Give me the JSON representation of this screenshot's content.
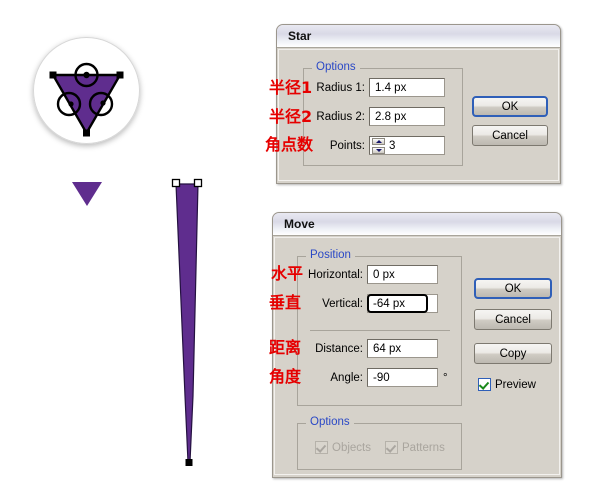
{
  "canvas": {
    "background": "#ffffff",
    "artwork": {
      "purple": "#5f2d8e",
      "outline": "#000000",
      "preview_circle_name": "star-tool-preview",
      "small_triangle_name": "small-purple-triangle",
      "spire_name": "elongated-purple-spire"
    }
  },
  "star_dialog": {
    "title": "Star",
    "group_legend": "Options",
    "fields": [
      {
        "label": "Radius 1:",
        "value": "1.4 px",
        "annotation": "半径1"
      },
      {
        "label": "Radius 2:",
        "value": "2.8 px",
        "annotation": "半径2"
      },
      {
        "label": "Points:",
        "value": "3",
        "annotation": "角点数"
      }
    ],
    "buttons": {
      "ok": "OK",
      "cancel": "Cancel"
    }
  },
  "move_dialog": {
    "title": "Move",
    "position_legend": "Position",
    "options_legend": "Options",
    "fields": [
      {
        "label": "Horizontal:",
        "value": "0 px",
        "annotation": "水平"
      },
      {
        "label": "Vertical:",
        "value": "-64 px",
        "annotation": "垂直"
      },
      {
        "label": "Distance:",
        "value": "64 px",
        "annotation": "距离"
      },
      {
        "label": "Angle:",
        "value": "-90",
        "annotation": "角度",
        "unit": "°"
      }
    ],
    "buttons": {
      "ok": "OK",
      "cancel": "Cancel",
      "copy": "Copy"
    },
    "preview": {
      "label": "Preview",
      "checked": true
    },
    "options": [
      {
        "label": "Objects",
        "checked": true,
        "disabled": true
      },
      {
        "label": "Patterns",
        "checked": true,
        "disabled": true
      }
    ]
  },
  "colors": {
    "dialog_face": "#d6d2ca",
    "legend_blue": "#2b49c6",
    "annotation_red": "#e60000",
    "accent_blue": "#2f5fb8",
    "check_green": "#1a8a1a"
  }
}
